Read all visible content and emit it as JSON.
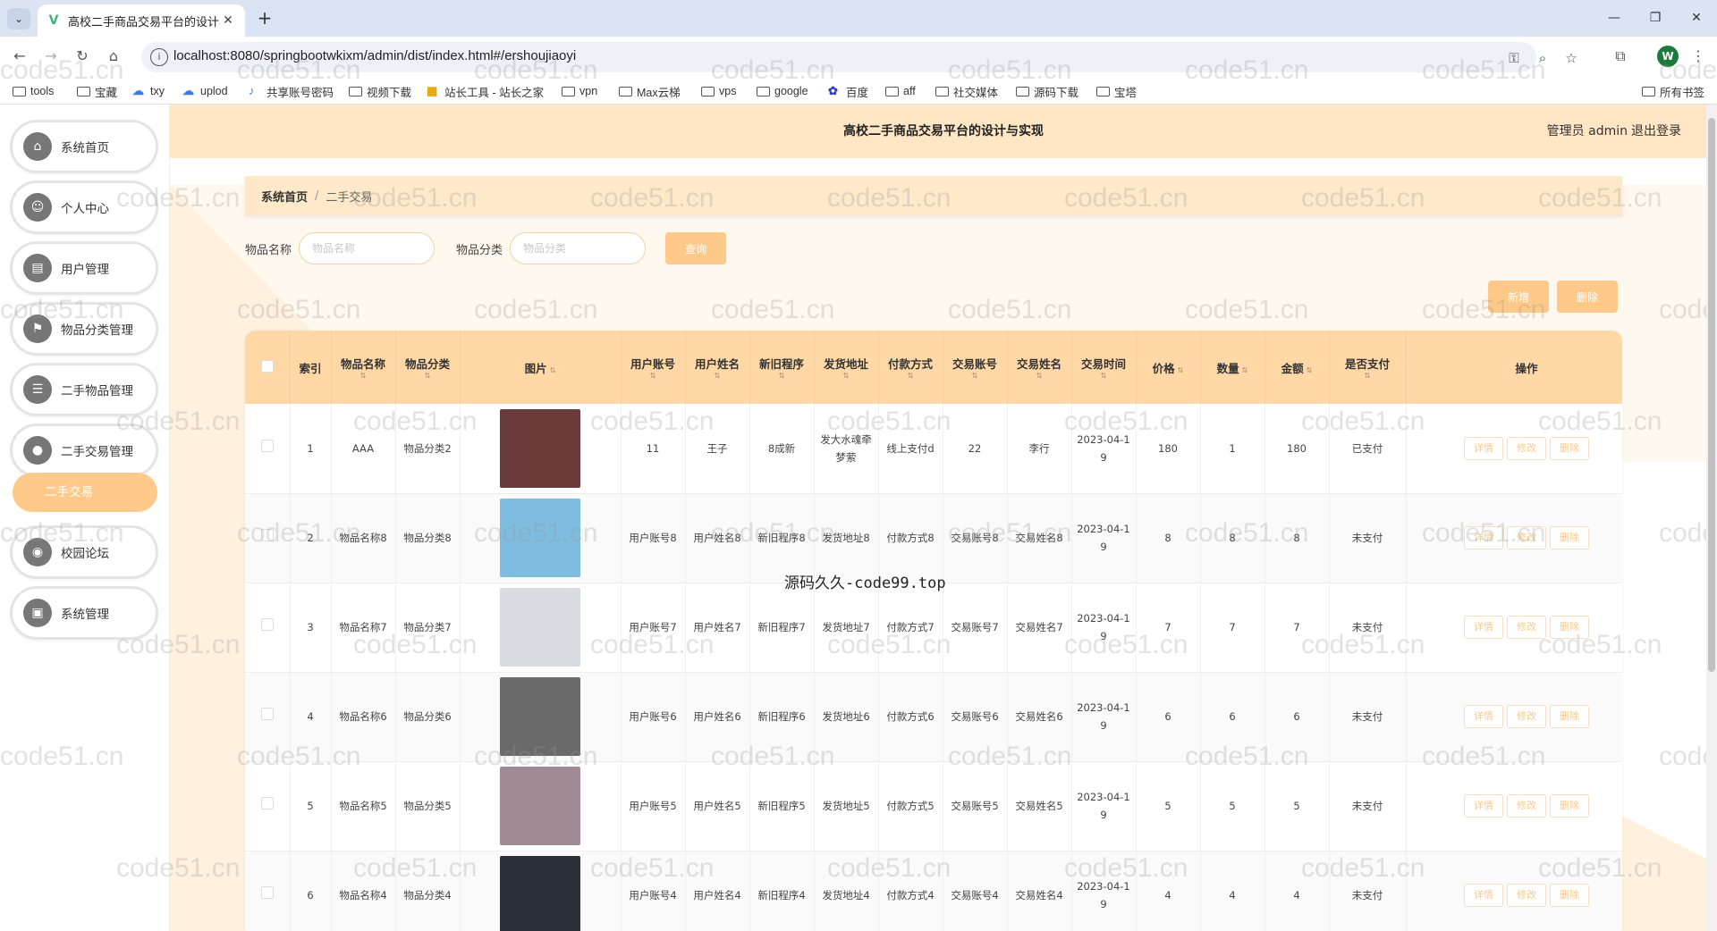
{
  "browser": {
    "tab_title": "高校二手商品交易平台的设计与",
    "url": "localhost:8080/springbootwkixm/admin/dist/index.html#/ershoujiaoyi",
    "profile_initial": "W",
    "bookmarks": [
      "tools",
      "宝藏",
      "txy",
      "uplod",
      "共享账号密码",
      "视频下载",
      "站长工具 - 站长之家",
      "vpn",
      "Max云梯",
      "vps",
      "google",
      "百度",
      "aff",
      "社交媒体",
      "源码下载",
      "宝塔"
    ],
    "all_bookmarks": "所有书签"
  },
  "header": {
    "title": "高校二手商品交易平台的设计与实现",
    "user": "管理员 admin",
    "logout": "退出登录"
  },
  "sidebar": {
    "items": [
      {
        "label": "系统首页",
        "icon": "home-icon"
      },
      {
        "label": "个人中心",
        "icon": "user-icon"
      },
      {
        "label": "用户管理",
        "icon": "users-icon"
      },
      {
        "label": "物品分类管理",
        "icon": "flag-icon"
      },
      {
        "label": "二手物品管理",
        "icon": "list-icon"
      },
      {
        "label": "二手交易管理",
        "icon": "bulb-icon"
      },
      {
        "label": "校园论坛",
        "icon": "camera-icon"
      },
      {
        "label": "系统管理",
        "icon": "system-icon"
      }
    ],
    "submenu_active": "二手交易"
  },
  "breadcrumb": {
    "home": "系统首页",
    "current": "二手交易"
  },
  "search": {
    "name_label": "物品名称",
    "name_placeholder": "物品名称",
    "cat_label": "物品分类",
    "cat_placeholder": "物品分类",
    "query": "查询"
  },
  "actions": {
    "add": "新增",
    "delete": "删除"
  },
  "table": {
    "headers": [
      "索引",
      "物品名称",
      "物品分类",
      "图片",
      "用户账号",
      "用户姓名",
      "新旧程序",
      "发货地址",
      "付款方式",
      "交易账号",
      "交易姓名",
      "交易时间",
      "价格",
      "数量",
      "金额",
      "是否支付",
      "操作"
    ],
    "row_buttons": {
      "detail": "详情",
      "edit": "修改",
      "delete": "删除"
    },
    "rows": [
      {
        "index": "1",
        "name": "AAA",
        "category": "物品分类2",
        "account": "11",
        "username": "王子",
        "condition": "8成新",
        "address": "发大水魂牵梦萦",
        "pay_method": "线上支付d",
        "trade_account": "22",
        "trade_name": "李行",
        "time": "2023-04-19",
        "price": "180",
        "qty": "1",
        "amount": "180",
        "paid": "已支付",
        "img_color": "#6b3a3a"
      },
      {
        "index": "2",
        "name": "物品名称8",
        "category": "物品分类8",
        "account": "用户账号8",
        "username": "用户姓名8",
        "condition": "新旧程序8",
        "address": "发货地址8",
        "pay_method": "付款方式8",
        "trade_account": "交易账号8",
        "trade_name": "交易姓名8",
        "time": "2023-04-19",
        "price": "8",
        "qty": "8",
        "amount": "8",
        "paid": "未支付",
        "img_color": "#7fbde0"
      },
      {
        "index": "3",
        "name": "物品名称7",
        "category": "物品分类7",
        "account": "用户账号7",
        "username": "用户姓名7",
        "condition": "新旧程序7",
        "address": "发货地址7",
        "pay_method": "付款方式7",
        "trade_account": "交易账号7",
        "trade_name": "交易姓名7",
        "time": "2023-04-19",
        "price": "7",
        "qty": "7",
        "amount": "7",
        "paid": "未支付",
        "img_color": "#d8dbe0"
      },
      {
        "index": "4",
        "name": "物品名称6",
        "category": "物品分类6",
        "account": "用户账号6",
        "username": "用户姓名6",
        "condition": "新旧程序6",
        "address": "发货地址6",
        "pay_method": "付款方式6",
        "trade_account": "交易账号6",
        "trade_name": "交易姓名6",
        "time": "2023-04-19",
        "price": "6",
        "qty": "6",
        "amount": "6",
        "paid": "未支付",
        "img_color": "#6a6a6a"
      },
      {
        "index": "5",
        "name": "物品名称5",
        "category": "物品分类5",
        "account": "用户账号5",
        "username": "用户姓名5",
        "condition": "新旧程序5",
        "address": "发货地址5",
        "pay_method": "付款方式5",
        "trade_account": "交易账号5",
        "trade_name": "交易姓名5",
        "time": "2023-04-19",
        "price": "5",
        "qty": "5",
        "amount": "5",
        "paid": "未支付",
        "img_color": "#a08a96"
      },
      {
        "index": "6",
        "name": "物品名称4",
        "category": "物品分类4",
        "account": "用户账号4",
        "username": "用户姓名4",
        "condition": "新旧程序4",
        "address": "发货地址4",
        "pay_method": "付款方式4",
        "trade_account": "交易账号4",
        "trade_name": "交易姓名4",
        "time": "2023-04-19",
        "price": "4",
        "qty": "4",
        "amount": "4",
        "paid": "未支付",
        "img_color": "#2a2f3a"
      }
    ]
  },
  "overlay_text": "源码久久-code99.top",
  "watermark_text": "code51.cn"
}
